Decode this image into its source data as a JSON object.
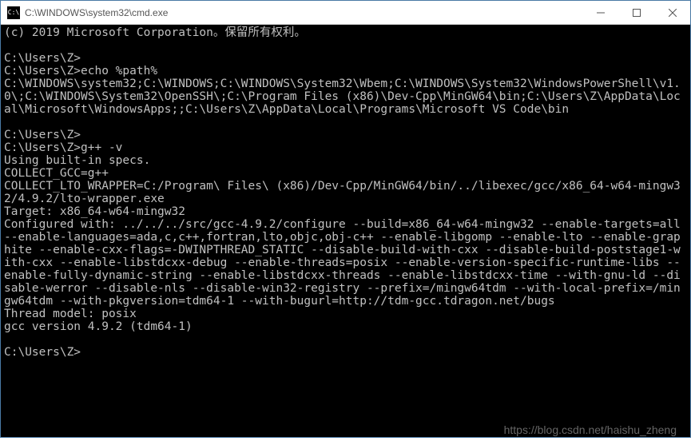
{
  "titlebar": {
    "icon_text": "C:\\",
    "title": "C:\\WINDOWS\\system32\\cmd.exe"
  },
  "terminal": {
    "lines": {
      "copyright": "(c) 2019 Microsoft Corporation。保留所有权利。",
      "blank": "",
      "prompt1": "C:\\Users\\Z>",
      "prompt2_cmd": "C:\\Users\\Z>echo %path%",
      "path_output": "C:\\WINDOWS\\system32;C:\\WINDOWS;C:\\WINDOWS\\System32\\Wbem;C:\\WINDOWS\\System32\\WindowsPowerShell\\v1.0\\;C:\\WINDOWS\\System32\\OpenSSH\\;C:\\Program Files (x86)\\Dev-Cpp\\MinGW64\\bin;C:\\Users\\Z\\AppData\\Local\\Microsoft\\WindowsApps;;C:\\Users\\Z\\AppData\\Local\\Programs\\Microsoft VS Code\\bin",
      "prompt3": "C:\\Users\\Z>",
      "prompt4_cmd": "C:\\Users\\Z>g++ -v",
      "using_specs": "Using built-in specs.",
      "collect_gcc": "COLLECT_GCC=g++",
      "collect_lto": "COLLECT_LTO_WRAPPER=C:/Program\\ Files\\ (x86)/Dev-Cpp/MinGW64/bin/../libexec/gcc/x86_64-w64-mingw32/4.9.2/lto-wrapper.exe",
      "target": "Target: x86_64-w64-mingw32",
      "configured": "Configured with: ../../../src/gcc-4.9.2/configure --build=x86_64-w64-mingw32 --enable-targets=all --enable-languages=ada,c,c++,fortran,lto,objc,obj-c++ --enable-libgomp --enable-lto --enable-graphite --enable-cxx-flags=-DWINPTHREAD_STATIC --disable-build-with-cxx --disable-build-poststage1-with-cxx --enable-libstdcxx-debug --enable-threads=posix --enable-version-specific-runtime-libs --enable-fully-dynamic-string --enable-libstdcxx-threads --enable-libstdcxx-time --with-gnu-ld --disable-werror --disable-nls --disable-win32-registry --prefix=/mingw64tdm --with-local-prefix=/mingw64tdm --with-pkgversion=tdm64-1 --with-bugurl=http://tdm-gcc.tdragon.net/bugs",
      "thread_model": "Thread model: posix",
      "gcc_version": "gcc version 4.9.2 (tdm64-1)",
      "prompt5": "C:\\Users\\Z>"
    }
  },
  "watermark": "https://blog.csdn.net/haishu_zheng"
}
